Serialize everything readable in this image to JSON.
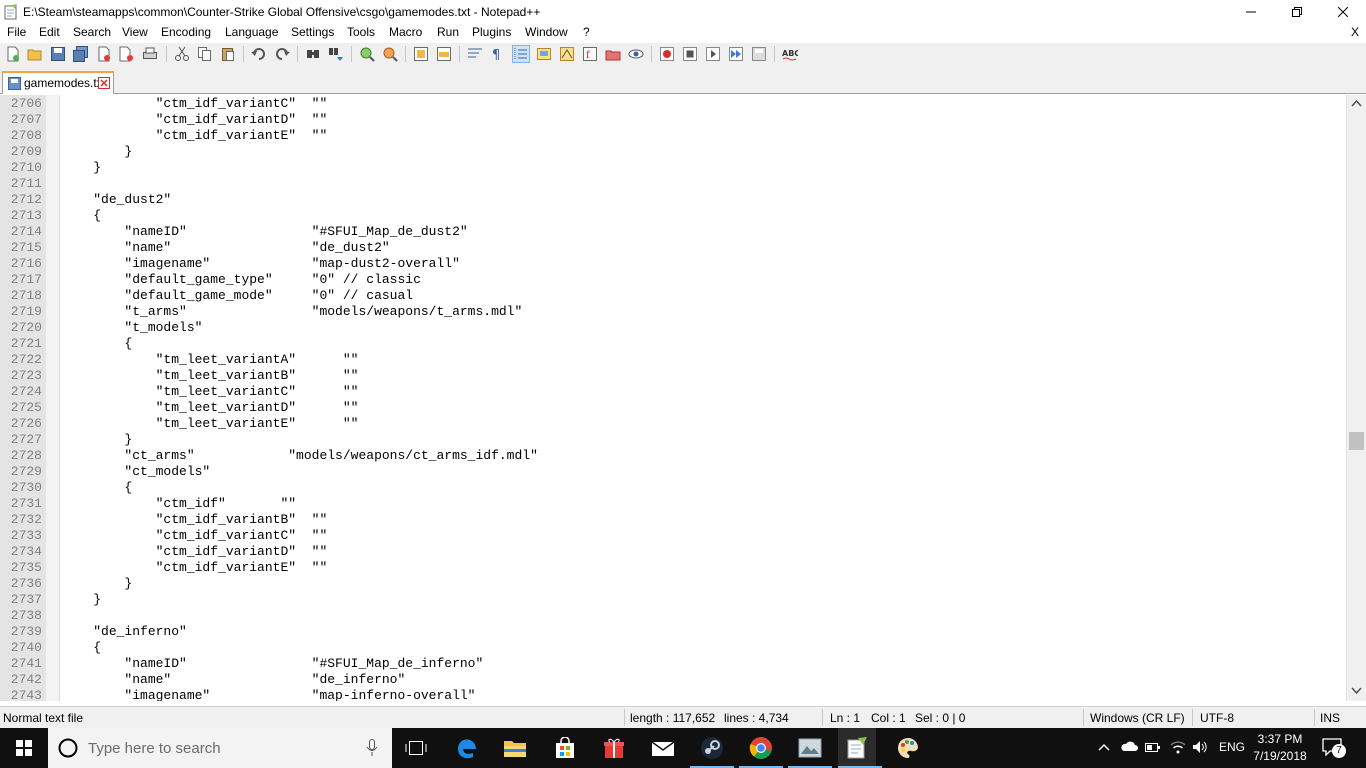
{
  "window": {
    "title": "E:\\Steam\\steamapps\\common\\Counter-Strike Global Offensive\\csgo\\gamemodes.txt - Notepad++",
    "doc_close": "X"
  },
  "menu": [
    "File",
    "Edit",
    "Search",
    "View",
    "Encoding",
    "Language",
    "Settings",
    "Tools",
    "Macro",
    "Run",
    "Plugins",
    "Window",
    "?"
  ],
  "tab": {
    "label": "gamemodes.txt"
  },
  "editor": {
    "lines": [
      {
        "n": "2706",
        "t": "\t\t\t\"ctm_idf_variantC\"  \"\""
      },
      {
        "n": "2707",
        "t": "\t\t\t\"ctm_idf_variantD\"  \"\""
      },
      {
        "n": "2708",
        "t": "\t\t\t\"ctm_idf_variantE\"  \"\""
      },
      {
        "n": "2709",
        "t": "\t\t}"
      },
      {
        "n": "2710",
        "t": "\t}"
      },
      {
        "n": "2711",
        "t": ""
      },
      {
        "n": "2712",
        "t": "\t\"de_dust2\""
      },
      {
        "n": "2713",
        "t": "\t{"
      },
      {
        "n": "2714",
        "t": "\t\t\"nameID\"                \"#SFUI_Map_de_dust2\""
      },
      {
        "n": "2715",
        "t": "\t\t\"name\"                  \"de_dust2\""
      },
      {
        "n": "2716",
        "t": "\t\t\"imagename\"             \"map-dust2-overall\""
      },
      {
        "n": "2717",
        "t": "\t\t\"default_game_type\"     \"0\" // classic"
      },
      {
        "n": "2718",
        "t": "\t\t\"default_game_mode\"     \"0\" // casual"
      },
      {
        "n": "2719",
        "t": "\t\t\"t_arms\"                \"models/weapons/t_arms.mdl\""
      },
      {
        "n": "2720",
        "t": "\t\t\"t_models\""
      },
      {
        "n": "2721",
        "t": "\t\t{"
      },
      {
        "n": "2722",
        "t": "\t\t\t\"tm_leet_variantA\"      \"\""
      },
      {
        "n": "2723",
        "t": "\t\t\t\"tm_leet_variantB\"      \"\""
      },
      {
        "n": "2724",
        "t": "\t\t\t\"tm_leet_variantC\"      \"\""
      },
      {
        "n": "2725",
        "t": "\t\t\t\"tm_leet_variantD\"      \"\""
      },
      {
        "n": "2726",
        "t": "\t\t\t\"tm_leet_variantE\"      \"\""
      },
      {
        "n": "2727",
        "t": "\t\t}"
      },
      {
        "n": "2728",
        "t": "\t\t\"ct_arms\"            \"models/weapons/ct_arms_idf.mdl\""
      },
      {
        "n": "2729",
        "t": "\t\t\"ct_models\""
      },
      {
        "n": "2730",
        "t": "\t\t{"
      },
      {
        "n": "2731",
        "t": "\t\t\t\"ctm_idf\"       \"\""
      },
      {
        "n": "2732",
        "t": "\t\t\t\"ctm_idf_variantB\"  \"\""
      },
      {
        "n": "2733",
        "t": "\t\t\t\"ctm_idf_variantC\"  \"\""
      },
      {
        "n": "2734",
        "t": "\t\t\t\"ctm_idf_variantD\"  \"\""
      },
      {
        "n": "2735",
        "t": "\t\t\t\"ctm_idf_variantE\"  \"\""
      },
      {
        "n": "2736",
        "t": "\t\t}"
      },
      {
        "n": "2737",
        "t": "\t}"
      },
      {
        "n": "2738",
        "t": ""
      },
      {
        "n": "2739",
        "t": "\t\"de_inferno\""
      },
      {
        "n": "2740",
        "t": "\t{"
      },
      {
        "n": "2741",
        "t": "\t\t\"nameID\"                \"#SFUI_Map_de_inferno\""
      },
      {
        "n": "2742",
        "t": "\t\t\"name\"                  \"de_inferno\""
      },
      {
        "n": "2743",
        "t": "\t\t\"imagename\"             \"map-inferno-overall\""
      }
    ]
  },
  "status": {
    "type": "Normal text file",
    "length": "length : 117,652",
    "lines": "lines : 4,734",
    "ln": "Ln : 1",
    "col": "Col : 1",
    "sel": "Sel : 0 | 0",
    "eol": "Windows (CR LF)",
    "encoding": "UTF-8",
    "mode": "INS"
  },
  "taskbar": {
    "search_placeholder": "Type here to search",
    "language": "ENG",
    "time": "3:37 PM",
    "date": "7/19/2018",
    "notification_count": "7"
  },
  "colors": {
    "gutter_bg": "#e4e4e4",
    "tab_accent": "#f6a24a",
    "taskbar_bg": "#101010",
    "chrome_bg": "#f0f0f0"
  }
}
